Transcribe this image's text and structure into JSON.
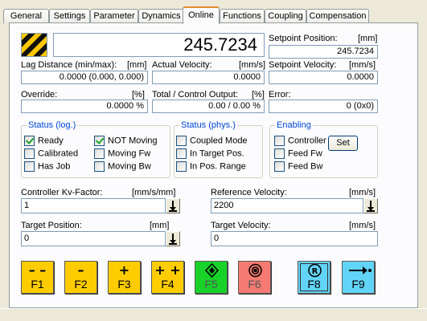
{
  "tabs": [
    "General",
    "Settings",
    "Parameter",
    "Dynamics",
    "Online",
    "Functions",
    "Coupling",
    "Compensation"
  ],
  "active_tab": "Online",
  "position": {
    "value": "245.7234"
  },
  "setpoint_position": {
    "label": "Setpoint Position:",
    "unit": "[mm]",
    "value": "245.7234"
  },
  "lag_distance": {
    "label": "Lag Distance (min/max):",
    "unit": "[mm]",
    "value": "0.0000  (0.000, 0.000)"
  },
  "actual_velocity": {
    "label": "Actual Velocity:",
    "unit": "[mm/s]",
    "value": "0.0000"
  },
  "setpoint_velocity": {
    "label": "Setpoint Velocity:",
    "unit": "[mm/s]",
    "value": "0.0000"
  },
  "override": {
    "label": "Override:",
    "unit": "[%]",
    "value": "0.0000 %"
  },
  "total_output": {
    "label": "Total / Control Output:",
    "unit": "[%]",
    "value": "0.00 /  0.00 %"
  },
  "error": {
    "label": "Error:",
    "value": "0 (0x0)"
  },
  "status_log": {
    "title": "Status (log.)",
    "items": [
      {
        "label": "Ready",
        "checked": true
      },
      {
        "label": "Calibrated",
        "checked": false
      },
      {
        "label": "Has Job",
        "checked": false
      },
      {
        "label": "NOT Moving",
        "checked": true
      },
      {
        "label": "Moving Fw",
        "checked": false
      },
      {
        "label": "Moving Bw",
        "checked": false
      }
    ]
  },
  "status_phys": {
    "title": "Status (phys.)",
    "items": [
      {
        "label": "Coupled Mode",
        "checked": false
      },
      {
        "label": "In Target Pos.",
        "checked": false
      },
      {
        "label": "In Pos. Range",
        "checked": false
      }
    ]
  },
  "enabling": {
    "title": "Enabling",
    "items": [
      {
        "label": "Controller",
        "checked": false
      },
      {
        "label": "Feed Fw",
        "checked": false
      },
      {
        "label": "Feed Bw",
        "checked": false
      }
    ],
    "set_label": "Set"
  },
  "controller_kv": {
    "label": "Controller Kv-Factor:",
    "unit": "[mm/s/mm]",
    "value": "1"
  },
  "reference_velocity": {
    "label": "Reference Velocity:",
    "unit": "[mm/s]",
    "value": "2200"
  },
  "target_position": {
    "label": "Target Position:",
    "unit": "[mm]",
    "value": "0"
  },
  "target_velocity": {
    "label": "Target Velocity:",
    "unit": "[mm/s]",
    "value": "0"
  },
  "function_keys": [
    {
      "key": "F1",
      "symbol": "– –",
      "icon": "fast-backward-icon",
      "color": "#ffcc00"
    },
    {
      "key": "F2",
      "symbol": "–",
      "icon": "backward-icon",
      "color": "#ffcc00"
    },
    {
      "key": "F3",
      "symbol": "+",
      "icon": "forward-icon",
      "color": "#ffcc00"
    },
    {
      "key": "F4",
      "symbol": "+ +",
      "icon": "fast-forward-icon",
      "color": "#ffcc00"
    },
    {
      "key": "F5",
      "symbol": "",
      "icon": "start-diamond-icon",
      "color": "#18d22a"
    },
    {
      "key": "F6",
      "symbol": "",
      "icon": "stop-circle-icon",
      "color": "#f47a72"
    },
    {
      "key": "F8",
      "symbol": "R",
      "icon": "reset-icon",
      "color": "#62d4f8"
    },
    {
      "key": "F9",
      "symbol": "→•",
      "icon": "move-to-target-icon",
      "color": "#62d4f8"
    }
  ]
}
